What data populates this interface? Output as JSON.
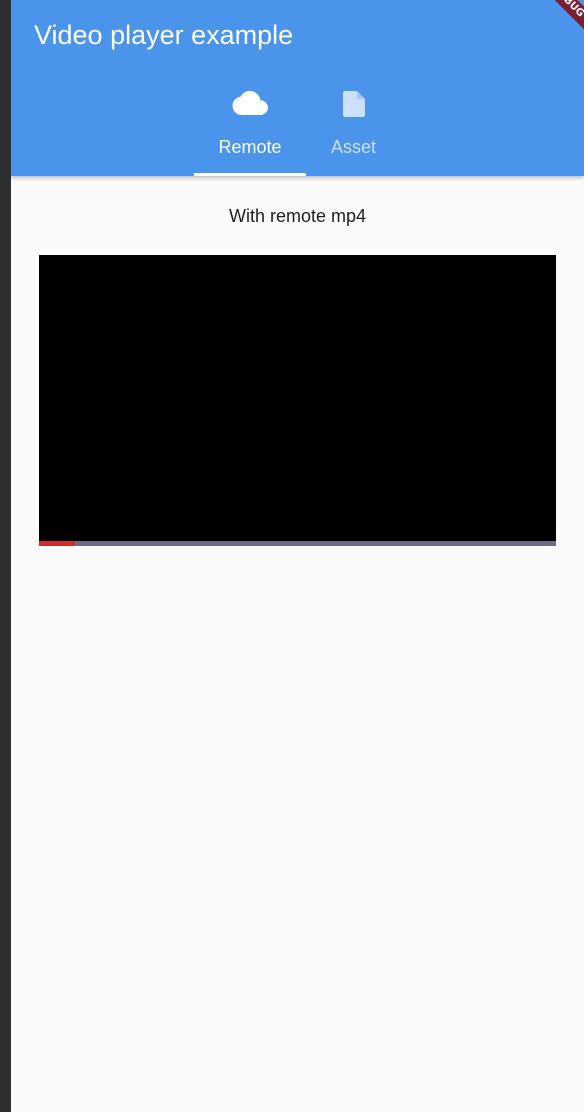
{
  "appbar": {
    "title": "Video player example",
    "color": "#4a94ec"
  },
  "tabs": [
    {
      "label": "Remote",
      "icon": "cloud-icon",
      "selected": true
    },
    {
      "label": "Asset",
      "icon": "file-icon",
      "selected": false
    }
  ],
  "debug_banner": {
    "text": "DEBUG"
  },
  "content": {
    "caption": "With remote mp4"
  },
  "video": {
    "progress_fraction": 0.07,
    "progress_color": "#d12b2b",
    "track_color": "#6e6a82"
  }
}
